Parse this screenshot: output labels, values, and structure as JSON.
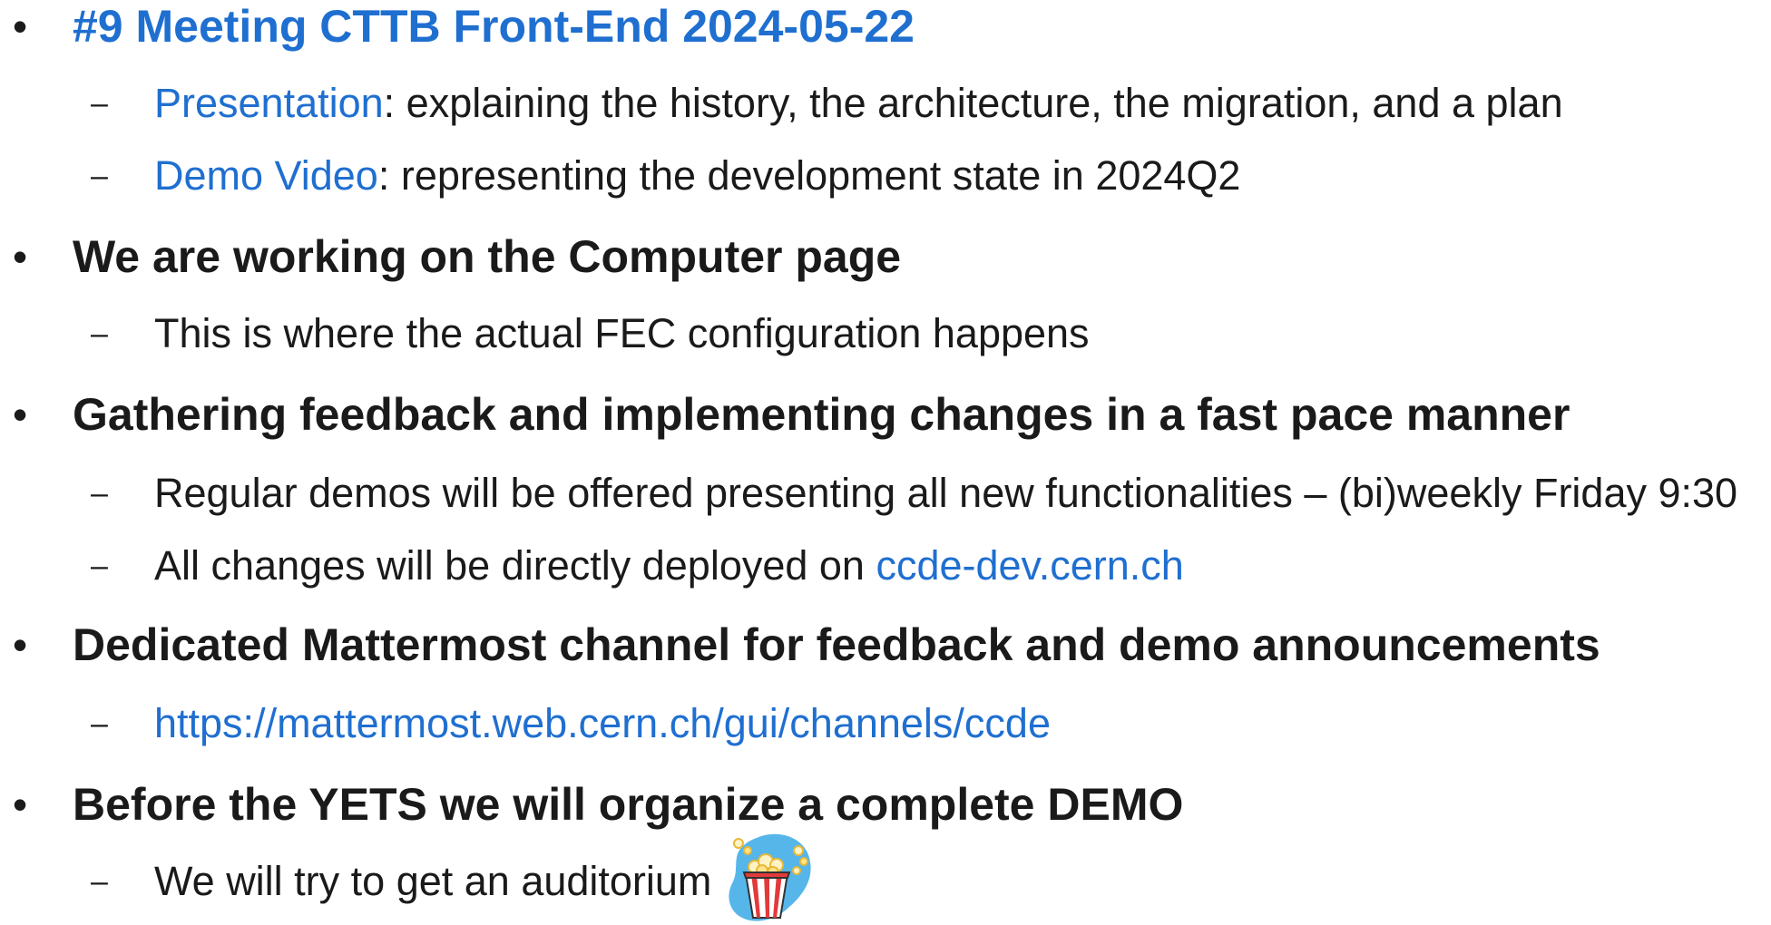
{
  "items": [
    {
      "heading": "#9 Meeting CTTB Front-End 2024-05-22",
      "heading_is_link": true,
      "subs": [
        {
          "link": "Presentation",
          "text": ": explaining the history, the architecture, the migration, and a plan"
        },
        {
          "link": "Demo Video",
          "text": ": representing the development state in 2024Q2"
        }
      ]
    },
    {
      "heading": "We are working on the Computer page",
      "subs": [
        {
          "text": "This is where the actual FEC configuration happens"
        }
      ]
    },
    {
      "heading": "Gathering feedback and implementing changes in a fast pace manner",
      "subs": [
        {
          "text": "Regular demos will be offered presenting all new functionalities – (bi)weekly Friday 9:30"
        },
        {
          "text": "All changes will be directly deployed on ",
          "link": "ccde-dev.cern.ch"
        }
      ]
    },
    {
      "heading": "Dedicated Mattermost channel for feedback and demo announcements",
      "subs": [
        {
          "link": "https://mattermost.web.cern.ch/gui/channels/ccde"
        }
      ]
    },
    {
      "heading": "Before the YETS we will organize a complete DEMO",
      "subs": [
        {
          "text": "We will try to get an auditorium",
          "icon": "popcorn-icon"
        }
      ]
    }
  ],
  "colors": {
    "link": "#1f6fd0",
    "text": "#1a1a1a"
  }
}
